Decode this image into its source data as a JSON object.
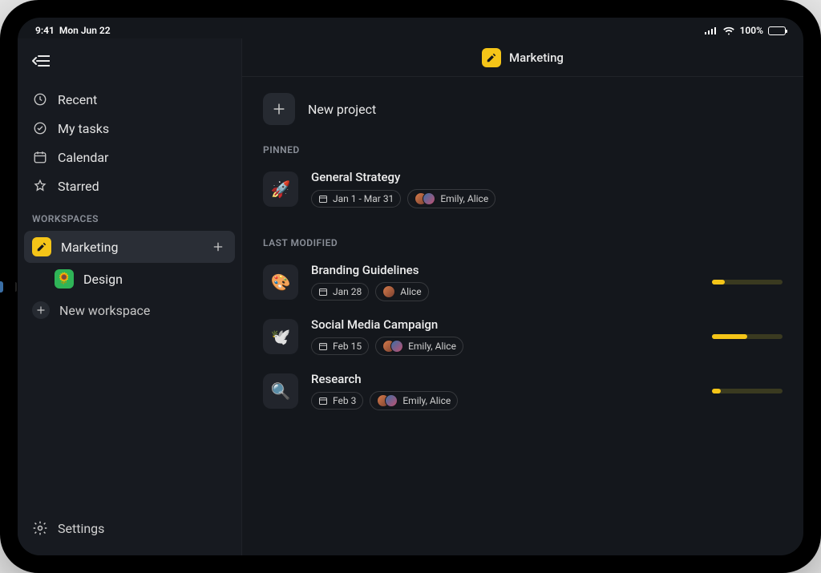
{
  "status": {
    "time": "9:41",
    "date": "Mon Jun 22",
    "battery_pct": "100%"
  },
  "sidebar": {
    "nav": {
      "recent": "Recent",
      "my_tasks": "My tasks",
      "calendar": "Calendar",
      "starred": "Starred"
    },
    "workspaces_header": "WORKSPACES",
    "workspaces": [
      {
        "label": "Marketing"
      },
      {
        "label": "Design"
      }
    ],
    "new_workspace": "New workspace",
    "settings": "Settings"
  },
  "header": {
    "title": "Marketing"
  },
  "new_project_label": "New project",
  "section_pinned": "PINNED",
  "section_last_modified": "LAST MODIFIED",
  "pinned": [
    {
      "title": "General Strategy",
      "date": "Jan 1 - Mar 31",
      "people": "Emily, Alice",
      "emoji": "🚀"
    }
  ],
  "last_modified": [
    {
      "title": "Branding Guidelines",
      "date": "Jan 28",
      "people": "Alice",
      "emoji": "🎨",
      "progress": 18
    },
    {
      "title": "Social Media Campaign",
      "date": "Feb 15",
      "people": "Emily, Alice",
      "emoji": "🕊️",
      "progress": 50
    },
    {
      "title": "Research",
      "date": "Feb 3",
      "people": "Emily, Alice",
      "emoji": "🔍",
      "progress": 12
    }
  ]
}
